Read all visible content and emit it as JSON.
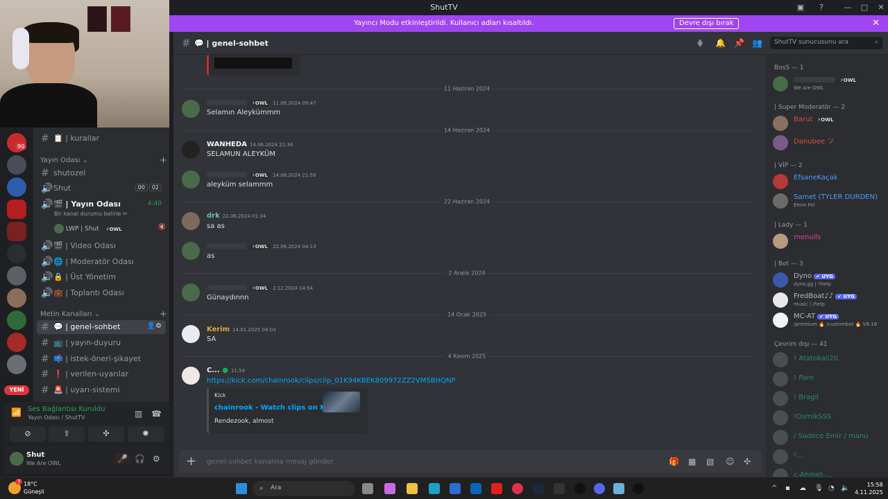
{
  "window": {
    "title": "ShutTV"
  },
  "banner": {
    "message": "Yayıncı Modu etkinleştirildi. Kullanıcı adları kısaltıldı.",
    "button": "Devre dışı bırak"
  },
  "rail": {
    "badge_count": "90",
    "new_label": "YENİ"
  },
  "channels": {
    "top_channel": "📋 | kurallar",
    "category_voice": "Yayın Odası",
    "shutozel": "shutozel",
    "shut_vc": "Shut",
    "shut_vc_counts": [
      "00",
      "02"
    ],
    "yayin_odasi": "🎬 | Yayın Odası",
    "yayin_timer": "4:40",
    "yayin_sub": "Bir kanal durumu belirle ✏",
    "vc_user": "LWP | Shut",
    "vc_user_badge": "⚡OWL",
    "video_odasi": "🎬 | Video Odası",
    "moderator_odasi": "🌐 | Moderatör Odası",
    "ust_yonetim": "🔒 | Üst Yönetim",
    "toplanti_odasi": "💼 | Toplantı Odası",
    "category_text": "Metin Kanalları",
    "genel_sohbet": "💬 | genel-sohbet",
    "yayin_duyuru": "📺 | yayın-duyuru",
    "istek": "📫 | istek-öneri-şikayet",
    "verilen_uyarilar": "❗ | verilen-uyarılar",
    "uyari_sistemi": "🚨 | uyarı-sistemi"
  },
  "voice_panel": {
    "status": "Ses Bağlantısı Kuruldu",
    "location": "Yayın Odası / ShutTV"
  },
  "user_panel": {
    "name": "Shut",
    "status": "We Are OWL"
  },
  "header": {
    "channel": "💬 | genel-sohbet",
    "search_placeholder": "ShutTV sunucusunu ara"
  },
  "messages": {
    "d1": "11 Haziran 2024",
    "m1_badge": "⚡OWL",
    "m1_time": "11.06.2024 09:47",
    "m1_text": "Selamın Aleykümmm",
    "d2": "14 Haziran 2024",
    "m2_name": "WANHEDA",
    "m2_time": "14.06.2024 21:34",
    "m2_text": "SELAMUN ALEYKÜM",
    "m3_badge": "⚡OWL",
    "m3_time": "14.06.2024 21:59",
    "m3_text": "aleyküm selammm",
    "d3": "22 Haziran 2024",
    "m4_name": "drk",
    "m4_time": "22.06.2024 01:34",
    "m4_text": "sa as",
    "m5_badge": "⚡OWL",
    "m5_time": "22.06.2024 04:13",
    "m5_text": "as",
    "d4": "2 Aralık 2024",
    "m6_badge": "⚡OWL",
    "m6_time": "2.12.2024 14:54",
    "m6_text": "Günaydınnn",
    "d5": "14 Ocak 2025",
    "m7_name": "Kerim",
    "m7_time": "14.01.2025 04:03",
    "m7_text": "SA",
    "d6": "4 Kasım 2025",
    "m8_name": "C...",
    "m8_time": "11:54",
    "m8_link": "https://kick.com/chainrook/clips/clip_01K94KBEK809972ZZ2VMSBHQNP",
    "embed_provider": "Kick",
    "embed_title": "chainrook - Watch clips on Kick",
    "embed_desc": "Rendezook, almost"
  },
  "composer": {
    "placeholder": "genel-sohbet kanalına mesaj gönder"
  },
  "members": {
    "g1": "BosS — 1",
    "boss1_status": "We Are OWL",
    "boss1_badge": "⚡OWL",
    "g2": "| Super Moderatör — 2",
    "sm1": "Barut",
    "sm1_badge": "⚡OWL",
    "sm2": "Danubee ツ",
    "g3": "| VİP — 2",
    "vip1": "EfsaneKaçak",
    "vip2": "Samet (TYLER DURDEN)",
    "vip2_status": "Emre Fel",
    "g4": "| Lady — 1",
    "lady1": "menulls",
    "g5": "| Bot — 3",
    "bot1": "Dyno",
    "bot1_status": "dyno.gg | ?help",
    "bot2": "FredBoat♪♪",
    "bot2_status": "music | /help",
    "bot3": "MC-AT",
    "bot3_status": "/premium 🔥 /custombot 🔥 V8.18",
    "uyg": "✔ UYG",
    "g6": "Çevrim dışı — 41",
    "off1": "! Atatokali20",
    "off2": "! Pare",
    "off3": "! Bragil",
    "off4": "!OsmikSSS",
    "off5": "/ Sadece Emir / manu",
    "off6": "!...",
    "off7": "c-Ahmet-..."
  },
  "taskbar": {
    "temp": "18°C",
    "weather": "Güneşli",
    "search": "Ara",
    "time": "15:58",
    "date": "4.11.2025",
    "notif": "7"
  },
  "colors": {
    "banner": "#a045f2",
    "online": "#23a55a",
    "link": "#00a8fc",
    "moderator": "#e04a3f",
    "vip": "#4e9bff",
    "lady": "#e0409c",
    "kerim": "#d6b03a",
    "drk": "#66c3a6"
  }
}
